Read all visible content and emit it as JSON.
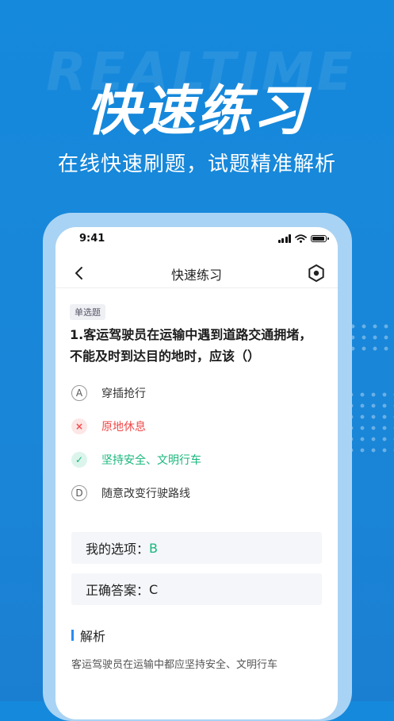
{
  "background_word": "REALTIME",
  "hero": {
    "title": "快速练习",
    "subtitle": "在线快速刷题，试题精准解析"
  },
  "status_bar": {
    "time": "9:41"
  },
  "nav": {
    "title": "快速练习",
    "back_icon": "chevron-left-icon",
    "settings_icon": "hexagon-settings-icon"
  },
  "question": {
    "type_badge": "单选题",
    "text": "1.客运驾驶员在运输中遇到道路交通拥堵，不能及时到达目的地时，应该（）",
    "options": [
      {
        "marker": "A",
        "text": "穿插抢行",
        "state": "normal"
      },
      {
        "marker": "×",
        "text": "原地休息",
        "state": "wrong"
      },
      {
        "marker": "✓",
        "text": "坚持安全、文明行车",
        "state": "correct"
      },
      {
        "marker": "D",
        "text": "随意改变行驶路线",
        "state": "normal"
      }
    ]
  },
  "answers": {
    "my_label": "我的选项：",
    "my_value": "B",
    "correct_label": "正确答案：",
    "correct_value": "C"
  },
  "analysis": {
    "title": "解析",
    "text": "客运驾驶员在运输中都应坚持安全、文明行车"
  },
  "colors": {
    "background": "#1589dc",
    "frame": "#a9d3f4",
    "correct": "#18b77c",
    "wrong": "#f04a4a",
    "accent": "#2a8df0"
  }
}
